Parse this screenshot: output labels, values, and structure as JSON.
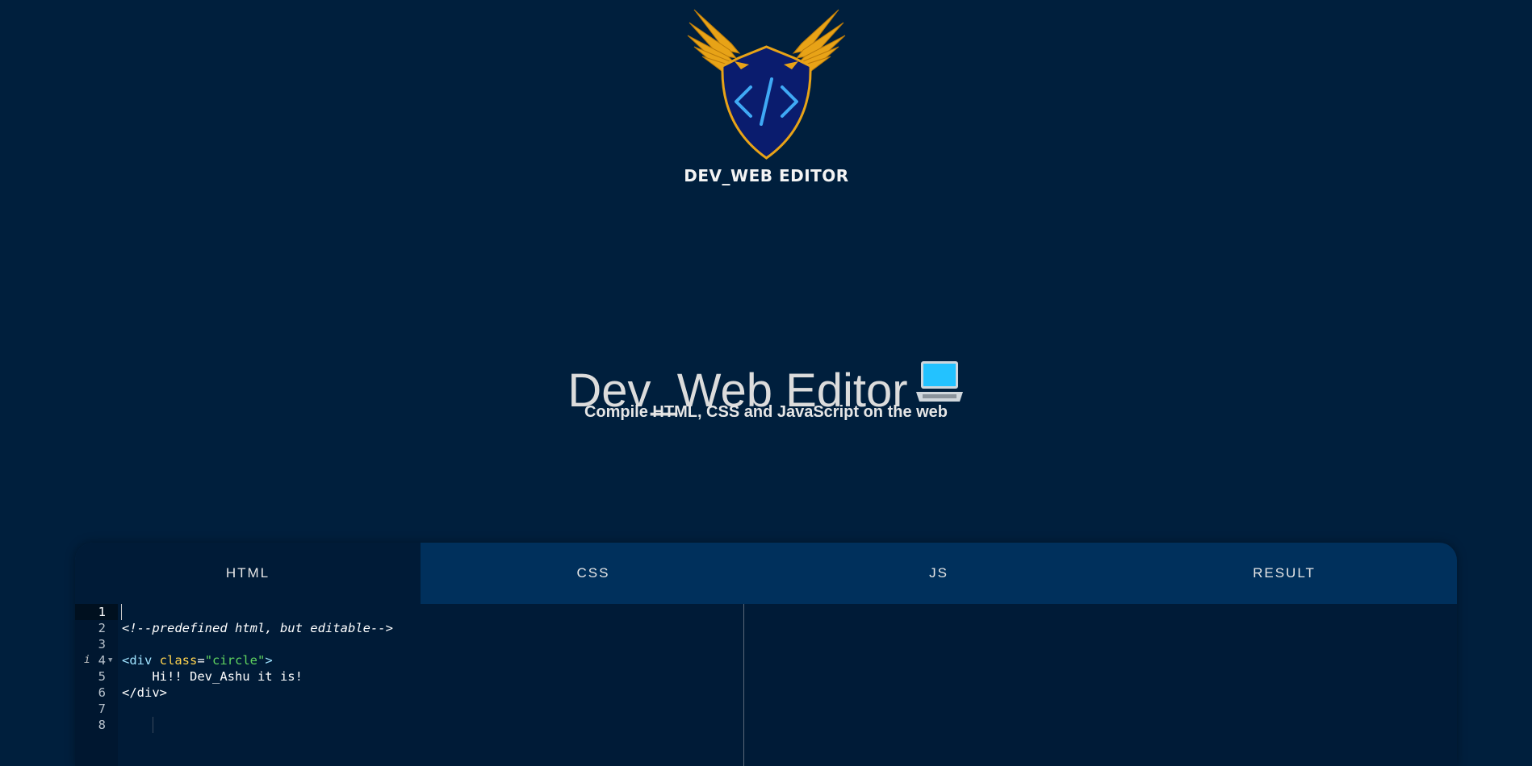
{
  "app": {
    "logo_text": "DEV_WEB EDITOR",
    "title": "Dev_Web Editor",
    "subtitle": "Compile HTML, CSS and JavaScript on the web",
    "title_icon": "laptop-icon"
  },
  "tabs": [
    {
      "label": "HTML",
      "active": true
    },
    {
      "label": "CSS",
      "active": false
    },
    {
      "label": "JS",
      "active": false
    },
    {
      "label": "RESULT",
      "active": false
    }
  ],
  "editor": {
    "active_line": 1,
    "lines": [
      {
        "num": "1",
        "text": ""
      },
      {
        "num": "2",
        "text": "<!--predefined html, but editable-->"
      },
      {
        "num": "3",
        "text": ""
      },
      {
        "num": "4",
        "text": "<div class=\"circle\">"
      },
      {
        "num": "5",
        "text": "    Hi!! Dev_Ashu it is!"
      },
      {
        "num": "6",
        "text": "</div>"
      },
      {
        "num": "7",
        "text": ""
      },
      {
        "num": "8",
        "text": ""
      }
    ],
    "line4_parts": {
      "open": "<div ",
      "attr": "class",
      "eq": "=",
      "str": "\"circle\"",
      "close": ">"
    },
    "line6_parts": {
      "tag": "</div>"
    }
  },
  "colors": {
    "background": "#001f3d",
    "tab_bar": "#00305c",
    "editor_bg": "#001b37",
    "logo_gold": "#e8a317",
    "logo_shield": "#0a1c6e",
    "code_comment": "#1e90ff",
    "code_tag": "#9fe3ff",
    "code_attr": "#ffd34e",
    "code_string": "#5fd35f"
  }
}
